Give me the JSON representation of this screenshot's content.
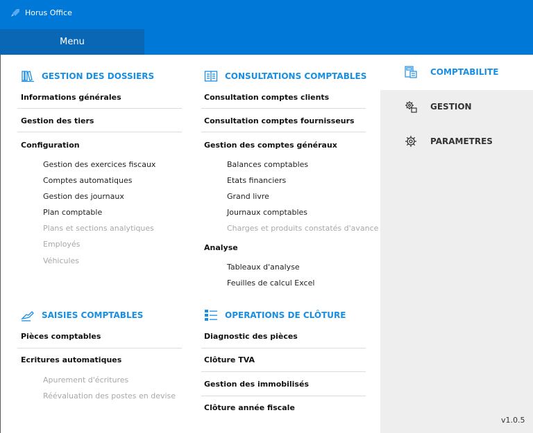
{
  "window": {
    "title": "Horus Office",
    "app_icon": "rocket-icon"
  },
  "menu": {
    "tab_label": "Menu"
  },
  "gestion_dossiers": {
    "title": "GESTION DES DOSSIERS",
    "icon": "books-icon",
    "items": [
      "Informations générales",
      "Gestion des tiers",
      "Configuration"
    ],
    "config_sub": [
      "Gestion des exercices fiscaux",
      "Comptes automatiques",
      "Gestion des journaux",
      "Plan comptable",
      "Plans et sections analytiques",
      "Employés",
      "Véhicules"
    ]
  },
  "consultations": {
    "title": "CONSULTATIONS COMPTABLES",
    "icon": "ledger-icon",
    "items": [
      "Consultation comptes clients",
      "Consultation comptes fournisseurs",
      "Gestion des comptes généraux"
    ],
    "generaux_sub": [
      "Balances comptables",
      "Etats financiers",
      "Grand livre",
      "Journaux comptables",
      "Charges et produits constatés d'avance"
    ],
    "analyse_label": "Analyse",
    "analyse_sub": [
      "Tableaux d'analyse",
      "Feuilles de calcul Excel"
    ]
  },
  "saisies": {
    "title": "SAISIES COMPTABLES",
    "icon": "writing-hand-icon",
    "items": [
      "Pièces comptables",
      "Ecritures automatiques"
    ],
    "ecritures_sub": [
      "Apurement d'écritures",
      "Réévaluation des postes en devise"
    ]
  },
  "cloture": {
    "title": "OPERATIONS DE CLÔTURE",
    "icon": "checklist-icon",
    "items": [
      "Diagnostic des pièces",
      "Clôture TVA",
      "Gestion des immobilisés",
      "Clôture année fiscale"
    ]
  },
  "nav": {
    "items": [
      {
        "label": "COMPTABILITE",
        "icon": "calculator-icon",
        "active": true
      },
      {
        "label": "GESTION",
        "icon": "gears-icon",
        "active": false
      },
      {
        "label": "PARAMETRES",
        "icon": "gear-icon",
        "active": false
      }
    ]
  },
  "version": "v1.0.5",
  "colors": {
    "titlebar": "#0078d7",
    "menu_tab": "#0a67b6",
    "accent": "#1a8ee1",
    "disabled": "#a8a8a8",
    "nav_bg": "#eeeeee"
  }
}
